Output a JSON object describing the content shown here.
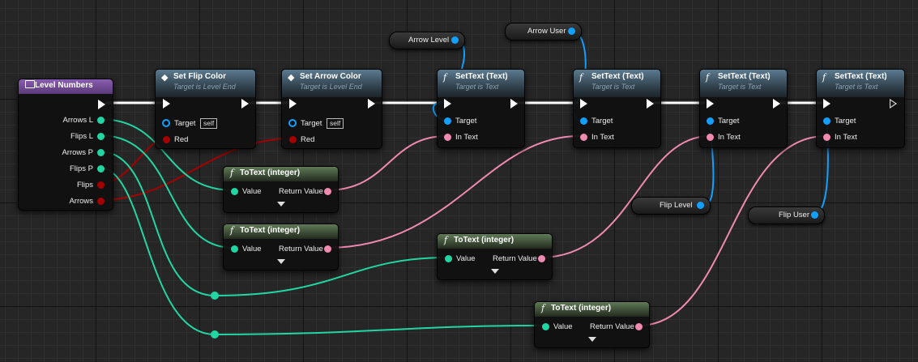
{
  "graph": {
    "level_numbers": {
      "title": "Level Numbers",
      "pins": [
        "Arrows L",
        "Flips L",
        "Arrows P",
        "Flips P",
        "Flips",
        "Arrows"
      ]
    },
    "set_flip_color": {
      "title": "Set Flip Color",
      "subtitle": "Target is Level End",
      "target": "Target",
      "self": "self",
      "color": "Red"
    },
    "set_arrow_color": {
      "title": "Set Arrow Color",
      "subtitle": "Target is Level End",
      "target": "Target",
      "self": "self",
      "color": "Red"
    },
    "settext": [
      {
        "title": "SetText (Text)",
        "subtitle": "Target is Text",
        "target": "Target",
        "in_text": "In Text"
      },
      {
        "title": "SetText (Text)",
        "subtitle": "Target is Text",
        "target": "Target",
        "in_text": "In Text"
      },
      {
        "title": "SetText (Text)",
        "subtitle": "Target is Text",
        "target": "Target",
        "in_text": "In Text"
      },
      {
        "title": "SetText (Text)",
        "subtitle": "Target is Text",
        "target": "Target",
        "in_text": "In Text"
      }
    ],
    "totext": [
      {
        "title": "ToText (integer)",
        "value": "Value",
        "return": "Return Value"
      },
      {
        "title": "ToText (integer)",
        "value": "Value",
        "return": "Return Value"
      },
      {
        "title": "ToText (integer)",
        "value": "Value",
        "return": "Return Value"
      },
      {
        "title": "ToText (integer)",
        "value": "Value",
        "return": "Return Value"
      }
    ],
    "variables": {
      "arrow_level": "Arrow Level",
      "arrow_user": "Arrow User",
      "flip_level": "Flip Level",
      "flip_user": "Flip User"
    }
  },
  "colors": {
    "exec": "#ffffff",
    "object": "#12a0ff",
    "text": "#f08ab0",
    "integer": "#22d6a4",
    "color": "#a40000"
  },
  "icons": {
    "function": "function-icon",
    "event": "set-color-icon",
    "struct": "struct-icon"
  }
}
